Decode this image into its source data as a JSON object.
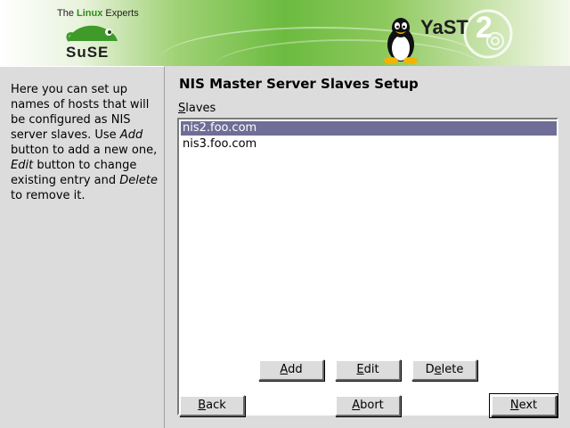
{
  "banner": {
    "tagline_pre": "The ",
    "tagline_brand": "Linux",
    "tagline_post": " Experts",
    "suse_logo_text": "SuSE",
    "yast_logo_text": "YaST",
    "yast_version": "2",
    "accent_green": "#6cbb40"
  },
  "help": {
    "line1": "Here you can set up names of hosts that will be configured as NIS server slaves. Use ",
    "add_word": "Add",
    "line2": " button to add a new one, ",
    "edit_word": "Edit",
    "line3": " button to change existing entry and ",
    "delete_word": "Delete",
    "line4": " to remove it."
  },
  "main": {
    "title": "NIS Master Server Slaves Setup",
    "list_label_first": "S",
    "list_label_rest": "laves",
    "slaves": [
      "nis2.foo.com",
      "nis3.foo.com"
    ],
    "selected_index": 0
  },
  "buttons": {
    "add_u": "A",
    "add_rest": "dd",
    "edit_u": "E",
    "edit_rest": "dit",
    "delete_pre": "D",
    "delete_u": "e",
    "delete_rest": "lete",
    "back_u": "B",
    "back_rest": "ack",
    "abort_u": "A",
    "abort_rest": "bort",
    "next_u": "N",
    "next_rest": "ext"
  }
}
